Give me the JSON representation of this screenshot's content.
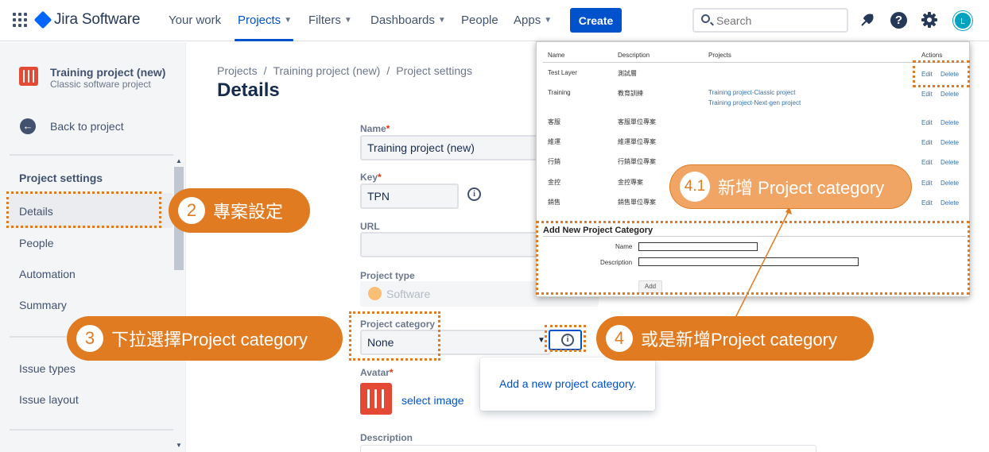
{
  "topnav": {
    "logo_text": "Jira Software",
    "items": [
      {
        "label": "Your work",
        "chevron": false
      },
      {
        "label": "Projects",
        "chevron": true
      },
      {
        "label": "Filters",
        "chevron": true
      },
      {
        "label": "Dashboards",
        "chevron": true
      },
      {
        "label": "People",
        "chevron": false
      },
      {
        "label": "Apps",
        "chevron": true
      }
    ],
    "create_label": "Create",
    "search_placeholder": "Search",
    "avatar_initial": "L",
    "help_glyph": "?"
  },
  "sidebar": {
    "project_name": "Training project (new)",
    "project_type": "Classic software project",
    "back_label": "Back to project",
    "heading": "Project settings",
    "items": [
      "Details",
      "People",
      "Automation",
      "Summary",
      "Issue types",
      "Issue layout"
    ]
  },
  "main": {
    "breadcrumb": [
      "Projects",
      "Training project (new)",
      "Project settings"
    ],
    "title": "Details",
    "fields": {
      "name_label": "Name",
      "name_value": "Training project (new)",
      "key_label": "Key",
      "key_value": "TPN",
      "url_label": "URL",
      "project_type_label": "Project type",
      "project_type_value": "Software",
      "category_label": "Project category",
      "category_value": "None",
      "avatar_label": "Avatar",
      "select_image": "select image",
      "description_label": "Description"
    },
    "popup_link": "Add a new project category."
  },
  "overlay": {
    "headers": [
      "Name",
      "Description",
      "Projects",
      "Actions"
    ],
    "rows": [
      {
        "name": "Test Layer",
        "description": "測試層",
        "projects": [],
        "edit": "Edit",
        "delete": "Delete"
      },
      {
        "name": "Training",
        "description": "教育訓練",
        "projects": [
          "Training project-Classic project",
          "Training project-Next-gen project"
        ],
        "edit": "Edit",
        "delete": "Delete"
      },
      {
        "name": "客服",
        "description": "客服單位專案",
        "projects": [],
        "edit": "Edit",
        "delete": "Delete"
      },
      {
        "name": "維運",
        "description": "維運單位專案",
        "projects": [],
        "edit": "Edit",
        "delete": "Delete"
      },
      {
        "name": "行銷",
        "description": "行銷單位專案",
        "projects": [],
        "edit": "Edit",
        "delete": "Delete"
      },
      {
        "name": "金控",
        "description": "金控專案",
        "projects": [],
        "edit": "Edit",
        "delete": "Delete"
      },
      {
        "name": "銷售",
        "description": "銷售單位專案",
        "projects": [],
        "edit": "Edit",
        "delete": "Delete"
      }
    ],
    "form_title": "Add New Project Category",
    "form_name_label": "Name",
    "form_desc_label": "Description",
    "add_button": "Add"
  },
  "callouts": [
    {
      "num": "2",
      "text": "專案設定"
    },
    {
      "num": "3",
      "text": "下拉選擇Project category"
    },
    {
      "num": "4",
      "text": "或是新增Project category"
    },
    {
      "num": "4.1",
      "text": "新增 Project category"
    }
  ],
  "colors": {
    "accent": "#0052cc",
    "annotation": "#e07b22",
    "project_icon": "#e34935"
  }
}
